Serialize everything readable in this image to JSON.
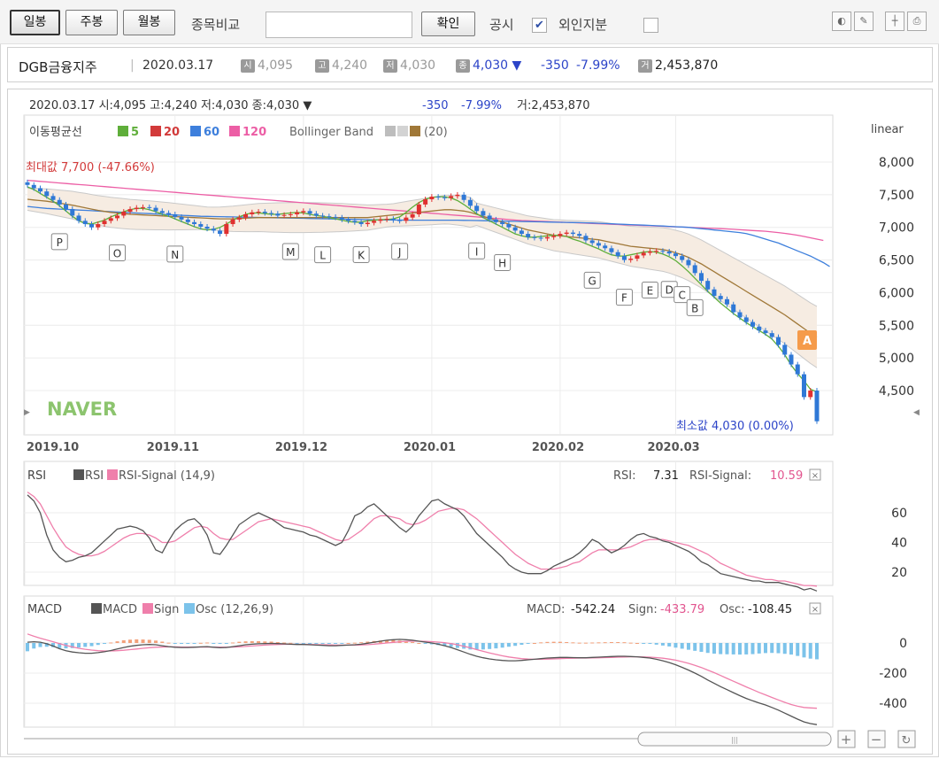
{
  "toolbar": {
    "daily": "일봉",
    "weekly": "주봉",
    "monthly": "월봉",
    "compare_label": "종목비교",
    "compare_value": "",
    "confirm": "확인",
    "disclosure": "공시",
    "disclosure_checked": true,
    "foreign_label": "외인지분",
    "foreign_checked": false,
    "icons": [
      "bulb-icon",
      "pencil-icon",
      "crosshair-icon",
      "print-icon"
    ]
  },
  "info": {
    "name": "DGB금융지주",
    "sep": "|",
    "date": "2020.03.17",
    "open_tag": "시",
    "open": "4,095",
    "high_tag": "고",
    "high": "4,240",
    "low_tag": "저",
    "low": "4,030",
    "close_tag": "종",
    "close": "4,030 ▼",
    "change": "-350",
    "change_pct": "-7.99%",
    "vol_tag": "거",
    "volume": "2,453,870"
  },
  "chart_header": {
    "line": "2020.03.17 시:4,095 고:4,240 저:4,030 종:4,030 ▼",
    "change": "-350",
    "pct": "-7.99%",
    "vol": "거:2,453,870"
  },
  "colors": {
    "up": "#e03030",
    "down": "#2f78d6",
    "ma5": "#5fae3a",
    "ma20": "#d23a3a",
    "ma60": "#3d7fdc",
    "ma120": "#ec5ea5",
    "bb_mid": "#a07838",
    "bb_band": "#f6ece2",
    "rsi": "#555555",
    "rsi_signal": "#ef7fab",
    "osc": "#7cc3ea"
  },
  "chart_data": [
    {
      "type": "candlestick",
      "scale_label": "linear",
      "legend": {
        "title": "이동평균선",
        "ma5": "5",
        "ma20": "20",
        "ma60": "60",
        "ma120": "120",
        "bb": "Bollinger Band",
        "bb_param": "(20)"
      },
      "x_labels": [
        "2019.10",
        "2019.11",
        "2019.12",
        "2020.01",
        "2020.02",
        "2020.03"
      ],
      "y_ticks": [
        "8,000",
        "7,500",
        "7,000",
        "6,500",
        "6,000",
        "5,500",
        "5,000",
        "4,500"
      ],
      "ylim": [
        4000,
        8300
      ],
      "max_label": "최대값 7,700 (-47.66%)",
      "min_label": "최소값 4,030 (0.00%)",
      "watermark": "NAVER",
      "markers": [
        "P",
        "O",
        "N",
        "M",
        "L",
        "K",
        "J",
        "I",
        "H",
        "G",
        "F",
        "E",
        "D",
        "C",
        "B"
      ],
      "disclosure_badge": "A",
      "closes": [
        7650,
        7600,
        7550,
        7480,
        7420,
        7350,
        7280,
        7180,
        7100,
        7050,
        7000,
        7050,
        7100,
        7140,
        7180,
        7240,
        7280,
        7300,
        7310,
        7300,
        7250,
        7220,
        7200,
        7160,
        7120,
        7080,
        7050,
        7010,
        6980,
        6950,
        6900,
        7050,
        7120,
        7150,
        7200,
        7230,
        7240,
        7220,
        7210,
        7180,
        7190,
        7200,
        7230,
        7250,
        7210,
        7180,
        7170,
        7160,
        7150,
        7120,
        7100,
        7080,
        7050,
        7070,
        7100,
        7120,
        7130,
        7110,
        7100,
        7150,
        7200,
        7350,
        7430,
        7470,
        7460,
        7450,
        7480,
        7500,
        7420,
        7330,
        7250,
        7180,
        7120,
        7080,
        7050,
        7000,
        6950,
        6900,
        6850,
        6840,
        6830,
        6850,
        6870,
        6900,
        6920,
        6900,
        6870,
        6800,
        6760,
        6720,
        6680,
        6620,
        6560,
        6500,
        6520,
        6570,
        6610,
        6630,
        6640,
        6630,
        6600,
        6560,
        6500,
        6420,
        6300,
        6180,
        6050,
        5950,
        5900,
        5820,
        5700,
        5620,
        5550,
        5480,
        5420,
        5380,
        5320,
        5200,
        5050,
        4900,
        4750,
        4400,
        4500,
        4030
      ],
      "ma5": [
        7620,
        7580,
        7520,
        7460,
        7400,
        7330,
        7250,
        7170,
        7100,
        7060,
        7050,
        7080,
        7110,
        7160,
        7200,
        7240,
        7270,
        7290,
        7290,
        7270,
        7240,
        7200,
        7170,
        7130,
        7090,
        7050,
        7010,
        6980,
        6960,
        6970,
        7000,
        7050,
        7110,
        7160,
        7200,
        7220,
        7220,
        7210,
        7200,
        7200,
        7210,
        7220,
        7230,
        7220,
        7200,
        7180,
        7170,
        7150,
        7130,
        7110,
        7090,
        7080,
        7080,
        7100,
        7110,
        7120,
        7120,
        7130,
        7160,
        7230,
        7310,
        7380,
        7430,
        7460,
        7470,
        7470,
        7450,
        7410,
        7350,
        7280,
        7210,
        7150,
        7100,
        7050,
        7000,
        6950,
        6900,
        6870,
        6850,
        6850,
        6860,
        6870,
        6880,
        6880,
        6860,
        6820,
        6790,
        6750,
        6710,
        6670,
        6620,
        6580,
        6560,
        6560,
        6580,
        6600,
        6620,
        6630,
        6620,
        6590,
        6550,
        6490,
        6410,
        6320,
        6220,
        6120,
        6020,
        5930,
        5840,
        5760,
        5680,
        5610,
        5540,
        5480,
        5420,
        5360,
        5290,
        5180,
        5050,
        4890,
        4760,
        4650,
        4520,
        4480
      ],
      "ma20": [
        7430,
        7420,
        7410,
        7400,
        7385,
        7370,
        7355,
        7340,
        7320,
        7300,
        7280,
        7260,
        7245,
        7230,
        7220,
        7210,
        7200,
        7195,
        7190,
        7185,
        7180,
        7175,
        7170,
        7165,
        7160,
        7155,
        7150,
        7145,
        7140,
        7135,
        7130,
        7130,
        7130,
        7135,
        7140,
        7145,
        7150,
        7150,
        7150,
        7150,
        7150,
        7150,
        7150,
        7150,
        7150,
        7150,
        7150,
        7150,
        7150,
        7150,
        7150,
        7150,
        7150,
        7150,
        7160,
        7170,
        7180,
        7190,
        7200,
        7210,
        7220,
        7230,
        7240,
        7250,
        7260,
        7270,
        7270,
        7260,
        7250,
        7230,
        7200,
        7170,
        7140,
        7110,
        7080,
        7050,
        7020,
        6990,
        6960,
        6940,
        6920,
        6900,
        6880,
        6870,
        6860,
        6850,
        6840,
        6830,
        6820,
        6810,
        6790,
        6770,
        6750,
        6730,
        6710,
        6700,
        6690,
        6680,
        6670,
        6660,
        6640,
        6610,
        6580,
        6540,
        6490,
        6440,
        6380,
        6320,
        6260,
        6200,
        6140,
        6080,
        6020,
        5960,
        5900,
        5840,
        5780,
        5720,
        5660,
        5590,
        5520,
        5450,
        5380,
        5320
      ],
      "ma60": [
        7320,
        7310,
        7300,
        7290,
        7285,
        7280,
        7275,
        7270,
        7265,
        7260,
        7255,
        7250,
        7245,
        7240,
        7235,
        7230,
        7225,
        7220,
        7215,
        7210,
        7205,
        7200,
        7195,
        7190,
        7185,
        7180,
        7175,
        7170,
        7168,
        7166,
        7164,
        7162,
        7160,
        7158,
        7156,
        7154,
        7152,
        7150,
        7148,
        7146,
        7144,
        7142,
        7140,
        7138,
        7136,
        7134,
        7132,
        7130,
        7128,
        7126,
        7124,
        7122,
        7120,
        7118,
        7116,
        7115,
        7114,
        7113,
        7112,
        7111,
        7110,
        7110,
        7110,
        7110,
        7110,
        7110,
        7110,
        7110,
        7108,
        7106,
        7104,
        7102,
        7100,
        7098,
        7096,
        7094,
        7092,
        7090,
        7088,
        7086,
        7084,
        7082,
        7080,
        7078,
        7076,
        7074,
        7072,
        7070,
        7066,
        7062,
        7058,
        7054,
        7050,
        7046,
        7042,
        7038,
        7034,
        7030,
        7025,
        7020,
        7015,
        7010,
        7005,
        7000,
        6990,
        6980,
        6970,
        6960,
        6950,
        6940,
        6930,
        6920,
        6905,
        6880,
        6850,
        6820,
        6790,
        6760,
        6720,
        6680,
        6640,
        6600,
        6560,
        6510,
        6460,
        6400
      ],
      "ma120": [
        7720,
        7712,
        7704,
        7696,
        7688,
        7680,
        7672,
        7664,
        7656,
        7648,
        7640,
        7632,
        7624,
        7616,
        7608,
        7600,
        7592,
        7584,
        7576,
        7568,
        7560,
        7552,
        7544,
        7536,
        7528,
        7520,
        7512,
        7504,
        7496,
        7488,
        7480,
        7472,
        7464,
        7456,
        7448,
        7440,
        7432,
        7424,
        7416,
        7408,
        7400,
        7392,
        7384,
        7376,
        7368,
        7360,
        7352,
        7344,
        7336,
        7328,
        7320,
        7312,
        7304,
        7296,
        7288,
        7280,
        7272,
        7264,
        7256,
        7248,
        7240,
        7232,
        7224,
        7216,
        7208,
        7200,
        7192,
        7184,
        7176,
        7168,
        7160,
        7152,
        7144,
        7136,
        7128,
        7120,
        7112,
        7104,
        7100,
        7096,
        7092,
        7088,
        7084,
        7080,
        7076,
        7072,
        7068,
        7064,
        7060,
        7056,
        7052,
        7048,
        7044,
        7040,
        7036,
        7032,
        7028,
        7024,
        7020,
        7016,
        7012,
        7008,
        7004,
        7000,
        6996,
        6992,
        6988,
        6984,
        6980,
        6976,
        6970,
        6964,
        6958,
        6952,
        6946,
        6940,
        6930,
        6920,
        6908,
        6895,
        6880,
        6860,
        6840,
        6820,
        6800
      ]
    },
    {
      "type": "line",
      "title": "RSI",
      "legend": [
        "RSI",
        "RSI-Signal (14,9)"
      ],
      "readout_rsi_label": "RSI:",
      "readout_rsi": "7.31",
      "readout_signal_label": "RSI-Signal:",
      "readout_signal": "10.59",
      "y_ticks": [
        "60",
        "40",
        "20"
      ],
      "ylim": [
        0,
        80
      ],
      "rsi": [
        72,
        68,
        60,
        45,
        35,
        30,
        27,
        28,
        30,
        31,
        33,
        37,
        41,
        45,
        49,
        50,
        51,
        50,
        48,
        43,
        35,
        33,
        41,
        48,
        52,
        55,
        56,
        52,
        45,
        33,
        32,
        38,
        45,
        52,
        55,
        58,
        60,
        58,
        56,
        53,
        50,
        49,
        48,
        47,
        45,
        44,
        42,
        40,
        38,
        40,
        48,
        58,
        60,
        64,
        66,
        62,
        58,
        54,
        50,
        47,
        51,
        58,
        63,
        68,
        69,
        66,
        64,
        62,
        58,
        52,
        46,
        42,
        38,
        34,
        30,
        25,
        22,
        20,
        19,
        19,
        19,
        21,
        24,
        26,
        28,
        30,
        33,
        37,
        42,
        40,
        36,
        33,
        35,
        38,
        42,
        45,
        46,
        44,
        43,
        41,
        40,
        38,
        36,
        34,
        31,
        27,
        25,
        22,
        19,
        18,
        17,
        16,
        15,
        14,
        14,
        13,
        13,
        13,
        12,
        11,
        10,
        8,
        9,
        7.31
      ],
      "signal": [
        74,
        71,
        66,
        58,
        50,
        43,
        37,
        34,
        32,
        31,
        31,
        32,
        34,
        37,
        40,
        43,
        45,
        46,
        46,
        45,
        43,
        40,
        40,
        41,
        44,
        47,
        50,
        51,
        50,
        46,
        43,
        42,
        42,
        45,
        48,
        51,
        54,
        55,
        56,
        55,
        54,
        53,
        52,
        51,
        50,
        48,
        46,
        44,
        42,
        41,
        42,
        45,
        48,
        52,
        56,
        58,
        58,
        57,
        56,
        53,
        52,
        53,
        55,
        58,
        61,
        62,
        63,
        63,
        62,
        59,
        56,
        52,
        48,
        44,
        40,
        36,
        32,
        29,
        26,
        24,
        22,
        22,
        22,
        23,
        24,
        26,
        27,
        30,
        33,
        35,
        35,
        35,
        35,
        36,
        37,
        39,
        41,
        42,
        42,
        42,
        41,
        40,
        39,
        38,
        36,
        34,
        32,
        29,
        26,
        24,
        22,
        20,
        18,
        17,
        16,
        15,
        15,
        14,
        14,
        13,
        12,
        11,
        11,
        10.59
      ]
    },
    {
      "type": "line+bar",
      "title": "MACD",
      "legend": [
        "MACD",
        "Sign",
        "Osc (12,26,9)"
      ],
      "readout_macd_label": "MACD:",
      "readout_macd": "-542.24",
      "readout_sign_label": "Sign:",
      "readout_sign": "-433.79",
      "readout_osc_label": "Osc:",
      "readout_osc": "-108.45",
      "y_ticks": [
        "0",
        "-200",
        "-400"
      ],
      "ylim": [
        -560,
        60
      ],
      "macd": [
        5,
        8,
        5,
        -5,
        -20,
        -38,
        -52,
        -60,
        -65,
        -68,
        -68,
        -64,
        -58,
        -50,
        -40,
        -30,
        -22,
        -16,
        -12,
        -10,
        -12,
        -18,
        -24,
        -28,
        -30,
        -30,
        -28,
        -26,
        -24,
        -28,
        -32,
        -30,
        -24,
        -18,
        -12,
        -8,
        -5,
        -4,
        -3,
        -4,
        -6,
        -8,
        -10,
        -10,
        -12,
        -14,
        -16,
        -18,
        -18,
        -16,
        -14,
        -12,
        -8,
        -2,
        5,
        12,
        18,
        22,
        24,
        22,
        18,
        12,
        6,
        0,
        -8,
        -18,
        -30,
        -45,
        -60,
        -75,
        -88,
        -98,
        -106,
        -112,
        -116,
        -118,
        -118,
        -116,
        -112,
        -108,
        -104,
        -100,
        -98,
        -96,
        -96,
        -97,
        -98,
        -98,
        -96,
        -94,
        -92,
        -90,
        -88,
        -88,
        -90,
        -92,
        -96,
        -100,
        -108,
        -118,
        -130,
        -145,
        -162,
        -180,
        -200,
        -222,
        -246,
        -268,
        -290,
        -310,
        -330,
        -350,
        -368,
        -384,
        -398,
        -412,
        -428,
        -446,
        -466,
        -486,
        -506,
        -524,
        -535,
        -542.24
      ],
      "sign": [
        60,
        45,
        32,
        20,
        8,
        -4,
        -16,
        -26,
        -35,
        -42,
        -47,
        -51,
        -53,
        -53,
        -51,
        -48,
        -44,
        -40,
        -35,
        -31,
        -28,
        -27,
        -26,
        -26,
        -27,
        -27,
        -27,
        -27,
        -27,
        -27,
        -28,
        -28,
        -27,
        -26,
        -23,
        -20,
        -17,
        -14,
        -12,
        -10,
        -9,
        -9,
        -9,
        -9,
        -10,
        -11,
        -12,
        -13,
        -14,
        -14,
        -14,
        -14,
        -13,
        -11,
        -8,
        -4,
        0,
        4,
        8,
        11,
        12,
        12,
        11,
        9,
        6,
        2,
        -4,
        -12,
        -22,
        -32,
        -44,
        -55,
        -66,
        -76,
        -85,
        -93,
        -99,
        -104,
        -107,
        -108,
        -108,
        -107,
        -106,
        -104,
        -102,
        -101,
        -100,
        -100,
        -99,
        -98,
        -97,
        -96,
        -94,
        -93,
        -92,
        -92,
        -93,
        -94,
        -97,
        -101,
        -107,
        -114,
        -124,
        -135,
        -148,
        -163,
        -180,
        -197,
        -216,
        -235,
        -254,
        -273,
        -292,
        -310,
        -328,
        -345,
        -362,
        -378,
        -394,
        -409,
        -420,
        -428,
        -431,
        -433.79
      ]
    }
  ]
}
